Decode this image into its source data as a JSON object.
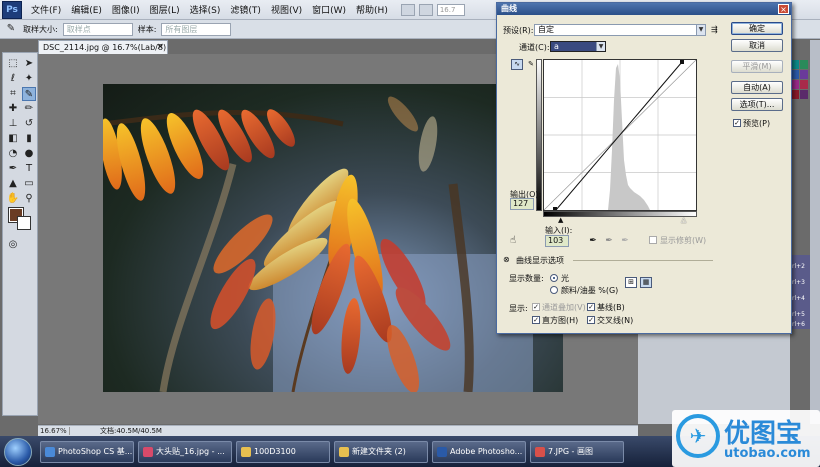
{
  "app": {
    "logo": "Ps",
    "menu": [
      "文件(F)",
      "编辑(E)",
      "图像(I)",
      "图层(L)",
      "选择(S)",
      "滤镜(T)",
      "视图(V)",
      "窗口(W)",
      "帮助(H)"
    ],
    "zoom_combo": "16.7"
  },
  "options_bar": {
    "sample_size_label": "取样大小:",
    "sample_size_value": "取样点",
    "sample_label": "样本:",
    "sample_value": "所有图层"
  },
  "document": {
    "tab_title": "DSC_2114.jpg @ 16.7%(Lab/8) *",
    "status_zoom": "16.67%",
    "status_doc": "文档:40.5M/40.5M"
  },
  "curves_dialog": {
    "title": "曲线",
    "preset_label": "预设(R):",
    "preset_value": "自定",
    "channel_label": "通道(C):",
    "channel_value": "a",
    "output_label": "输出(O):",
    "output_value": "127",
    "input_label": "输入(I):",
    "input_value": "103",
    "show_clipping_label": "显示修剪(W)",
    "display_options_label": "曲线显示选项",
    "show_amount_label": "显示数量:",
    "radio_light": "光",
    "radio_pigment": "颜料/油墨 %(G)",
    "show_label": "显示:",
    "channel_overlay": "通道叠加(V)",
    "baseline": "基线(B)",
    "histogram": "直方图(H)",
    "intersection": "交叉线(N)",
    "buttons": {
      "ok": "确定",
      "cancel": "取消",
      "smooth": "平滑(M)",
      "auto": "自动(A)",
      "options": "选项(T)..."
    },
    "preview_label": "预览(P)"
  },
  "layers_strip": [
    "rl+2",
    "rl+3",
    "rl+4",
    "rl+5",
    "rl+6"
  ],
  "taskbar": [
    {
      "label": "PhotoShop CS 基...",
      "color": "#4a8ad8"
    },
    {
      "label": "大头贴_16.jpg - ...",
      "color": "#d84a6a"
    },
    {
      "label": "100D3100",
      "color": "#e8c050"
    },
    {
      "label": "新建文件夹 (2)",
      "color": "#e8c050"
    },
    {
      "label": "Adobe Photosho...",
      "color": "#2a5aa8"
    },
    {
      "label": "7.JPG - 画图",
      "color": "#d8504a"
    }
  ],
  "watermark": {
    "name": "优图宝",
    "url": "utobao.com"
  },
  "colors": {
    "foreground": "#6a3c24",
    "background": "#ffffff",
    "title_bar": "#2b4f88"
  }
}
